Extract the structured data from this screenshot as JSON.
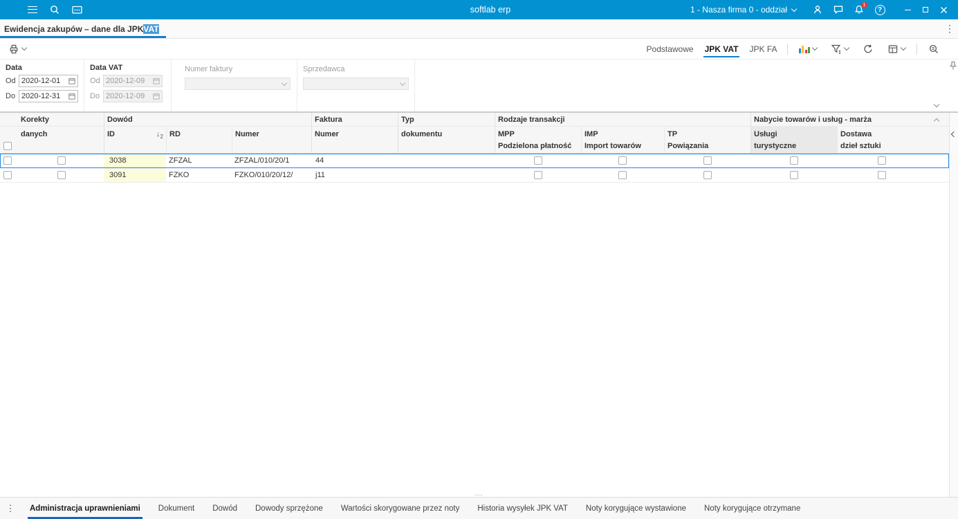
{
  "colors": {
    "topbar": "#0292d2",
    "accent": "#1080d0",
    "selection": "#1e88e5",
    "id_cell": "#fcfcdb",
    "badge": "#e53935"
  },
  "topbar": {
    "title": "softlab erp",
    "company": "1 - Nasza firma 0 - oddział",
    "badge_count": "1"
  },
  "doc_tab": {
    "title_prefix": "Ewidencja zakupów – dane dla JPK ",
    "title_highlight": "VAT"
  },
  "toolbar": {
    "views": [
      "Podstawowe",
      "JPK VAT",
      "JPK FA"
    ]
  },
  "filters": {
    "data": {
      "title": "Data",
      "od": "Od",
      "do": "Do",
      "od_value": "2020-12-01",
      "do_value": "2020-12-31"
    },
    "data_vat": {
      "title": "Data VAT",
      "od": "Od",
      "do": "Do",
      "od_value": "2020-12-09",
      "do_value": "2020-12-09"
    },
    "numer_faktury": "Numer faktury",
    "sprzedawca": "Sprzedawca"
  },
  "grid": {
    "groups": {
      "korekty": "Korekty",
      "dowod": "Dowód",
      "faktura": "Faktura",
      "typ": "Typ",
      "rodzaje": "Rodzaje transakcji",
      "nabycie": "Nabycie towarów i usług - marża"
    },
    "columns": {
      "danych": "danych",
      "id": "ID",
      "sort_icon": "↓",
      "sort_order": "2",
      "rd": "RD",
      "numer": "Numer",
      "faktura_numer": "Numer",
      "dokumentu": "dokumentu",
      "mpp": "MPP",
      "mpp_sub": "Podzielona płatność",
      "imp": "IMP",
      "imp_sub": "Import towarów",
      "tp": "TP",
      "tp_sub": "Powiązania",
      "uslugi": "Usługi",
      "uslugi_sub": "turystyczne",
      "dostawa": "Dostawa",
      "dostawa_sub": "dzieł sztuki"
    },
    "rows": [
      {
        "id": "3038",
        "rd": "ZFZAL",
        "numer": "ZFZAL/010/20/1",
        "faktura": "44"
      },
      {
        "id": "3091",
        "rd": "FZKO",
        "numer": "FZKO/010/20/12/",
        "faktura": "j11"
      }
    ]
  },
  "bottom_tabs": [
    "Administracja uprawnieniami",
    "Dokument",
    "Dowód",
    "Dowody sprzężone",
    "Wartości skorygowane przez noty",
    "Historia wysyłek JPK VAT",
    "Noty korygujące wystawione",
    "Noty korygujące otrzymane"
  ]
}
